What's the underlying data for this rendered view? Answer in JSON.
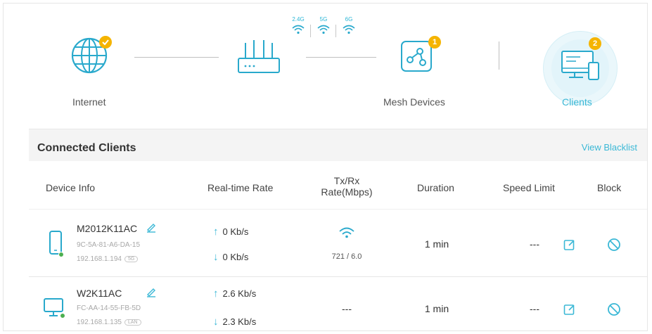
{
  "topology": {
    "internet": {
      "label": "Internet",
      "icon": "globe-icon",
      "status": "connected"
    },
    "router": {
      "icon": "router-icon",
      "bands": [
        "2.4G",
        "5G",
        "6G"
      ]
    },
    "mesh": {
      "label": "Mesh Devices",
      "icon": "mesh-network-icon",
      "count": "1"
    },
    "clients": {
      "label": "Clients",
      "icon": "devices-icon",
      "count": "2"
    }
  },
  "panel": {
    "title": "Connected Clients",
    "blacklist_link": "View Blacklist"
  },
  "table": {
    "headers": {
      "device_info": "Device Info",
      "realtime_rate": "Real-time Rate",
      "txrx_line1": "Tx/Rx",
      "txrx_line2": "Rate(Mbps)",
      "duration": "Duration",
      "speed_limit": "Speed Limit",
      "block": "Block"
    },
    "rows": [
      {
        "name": "M2012K11AC",
        "mac": "9C-5A-81-A6-DA-15",
        "ip": "192.168.1.194",
        "conn_tag": "5G",
        "device_icon": "phone-icon",
        "up": "0 Kb/s",
        "down": "0 Kb/s",
        "txrx": "721 / 6.0",
        "duration": "1 min",
        "speed_limit": "---"
      },
      {
        "name": "W2K11AC",
        "mac": "FC-AA-14-55-FB-5D",
        "ip": "192.168.1.135",
        "conn_tag": "LAN",
        "device_icon": "desktop-icon",
        "up": "2.6 Kb/s",
        "down": "2.3 Kb/s",
        "txrx": "---",
        "duration": "1 min",
        "speed_limit": "---"
      }
    ]
  },
  "colors": {
    "accent": "#3bb8d6",
    "badge": "#f5b400",
    "online_dot": "#4caf50"
  }
}
